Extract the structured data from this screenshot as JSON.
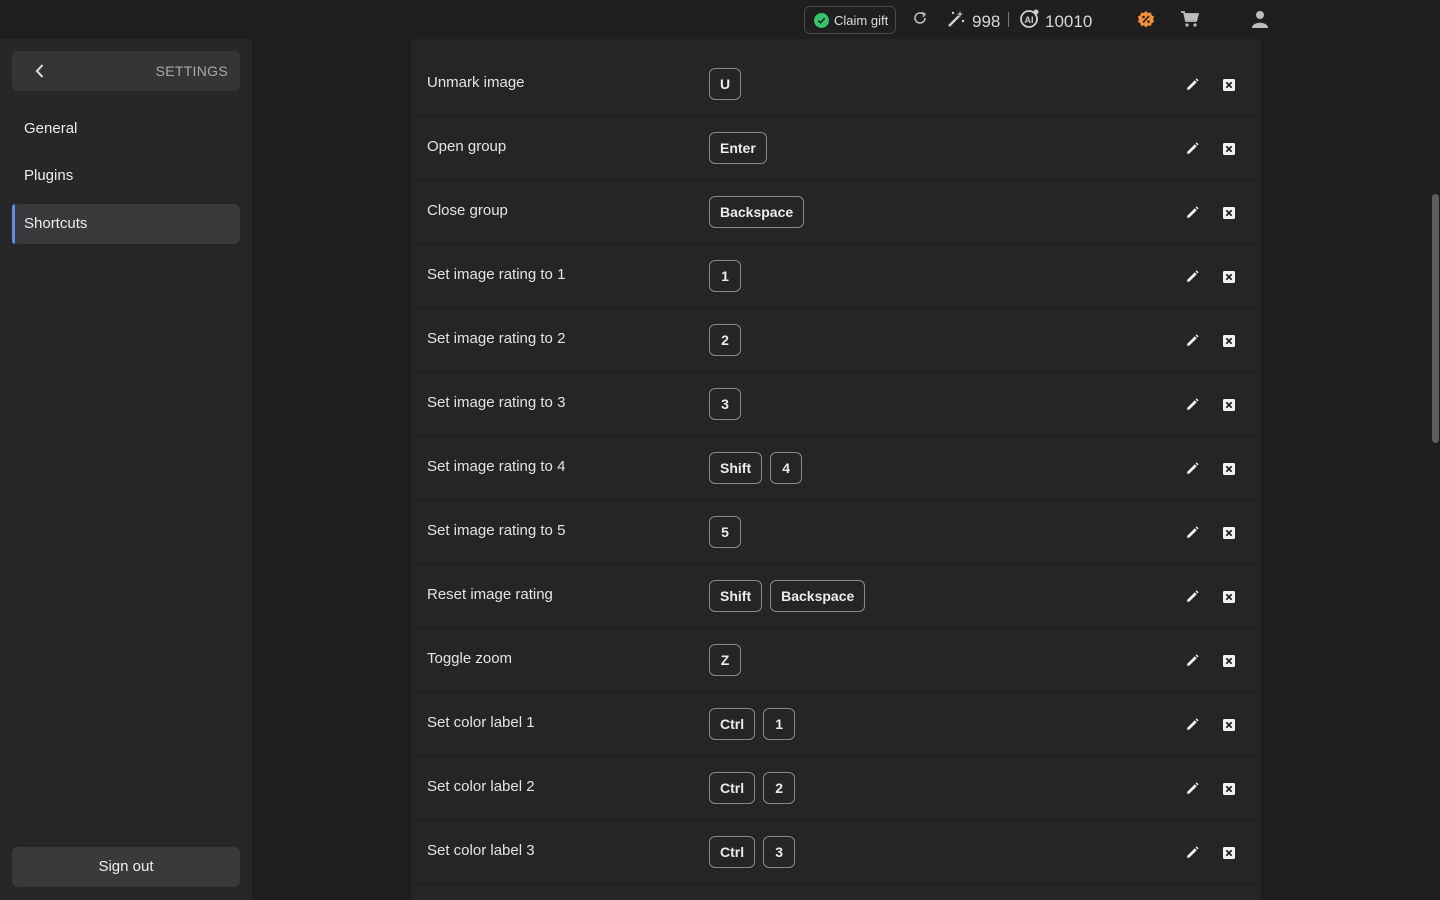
{
  "topbar": {
    "claim_gift": "Claim gift",
    "credits_count": "998",
    "ai_count": "10010",
    "icons": [
      "check-circle-icon",
      "refresh-icon",
      "magic-wand-icon",
      "ai-credit-icon",
      "discount-badge-icon",
      "cart-icon",
      "user-icon"
    ]
  },
  "sidebar": {
    "title": "SETTINGS",
    "items": [
      {
        "label": "General"
      },
      {
        "label": "Plugins"
      },
      {
        "label": "Shortcuts",
        "active": true
      }
    ],
    "signout": "Sign out"
  },
  "shortcuts": [
    {
      "label": "Unmark image",
      "keys": [
        "U"
      ]
    },
    {
      "label": "Open group",
      "keys": [
        "Enter"
      ]
    },
    {
      "label": "Close group",
      "keys": [
        "Backspace"
      ]
    },
    {
      "label": "Set image rating to 1",
      "keys": [
        "1"
      ]
    },
    {
      "label": "Set image rating to 2",
      "keys": [
        "2"
      ]
    },
    {
      "label": "Set image rating to 3",
      "keys": [
        "3"
      ]
    },
    {
      "label": "Set image rating to 4",
      "keys": [
        "Shift",
        "4"
      ]
    },
    {
      "label": "Set image rating to 5",
      "keys": [
        "5"
      ]
    },
    {
      "label": "Reset image rating",
      "keys": [
        "Shift",
        "Backspace"
      ]
    },
    {
      "label": "Toggle zoom",
      "keys": [
        "Z"
      ]
    },
    {
      "label": "Set color label 1",
      "keys": [
        "Ctrl",
        "1"
      ]
    },
    {
      "label": "Set color label 2",
      "keys": [
        "Ctrl",
        "2"
      ]
    },
    {
      "label": "Set color label 3",
      "keys": [
        "Ctrl",
        "3"
      ]
    }
  ],
  "colors": {
    "accent": "#5a8ee8",
    "success": "#34c46a",
    "discount": "#f0913a"
  }
}
